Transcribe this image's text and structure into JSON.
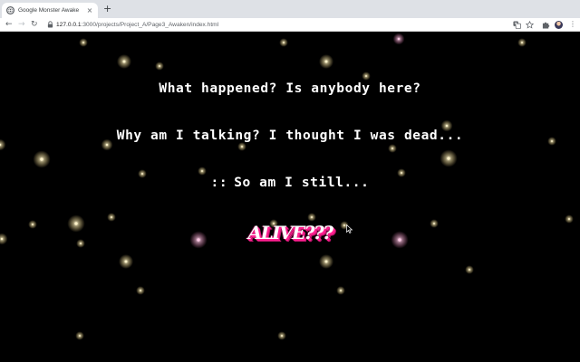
{
  "browser": {
    "tab_title": "Google Monster Awake",
    "tab_close": "×",
    "new_tab": "+",
    "nav": {
      "back": "←",
      "forward": "→",
      "reload": "↻"
    },
    "url_host": "127.0.0.1",
    "url_rest": ":3000/projects/Project_A/Page3_Awaken/index.html",
    "menu": "⋮"
  },
  "page": {
    "line1": "What happened? Is anybody here?",
    "line2": "Why am I talking? I thought I was dead...",
    "line3_mark": "::",
    "line3": "So am I still...",
    "alive": "ALIVE???"
  },
  "colors": {
    "background": "#000000",
    "text": "#ffffff",
    "alive_shadow": "#ff1f8f",
    "star_warm": "#fff3c8",
    "star_pink": "#ffc8e6"
  },
  "icons": [
    "lock-icon",
    "translate-icon",
    "star-icon",
    "puzzle-icon",
    "avatar",
    "kebab-menu-icon",
    "globe-icon",
    "cursor-icon"
  ]
}
